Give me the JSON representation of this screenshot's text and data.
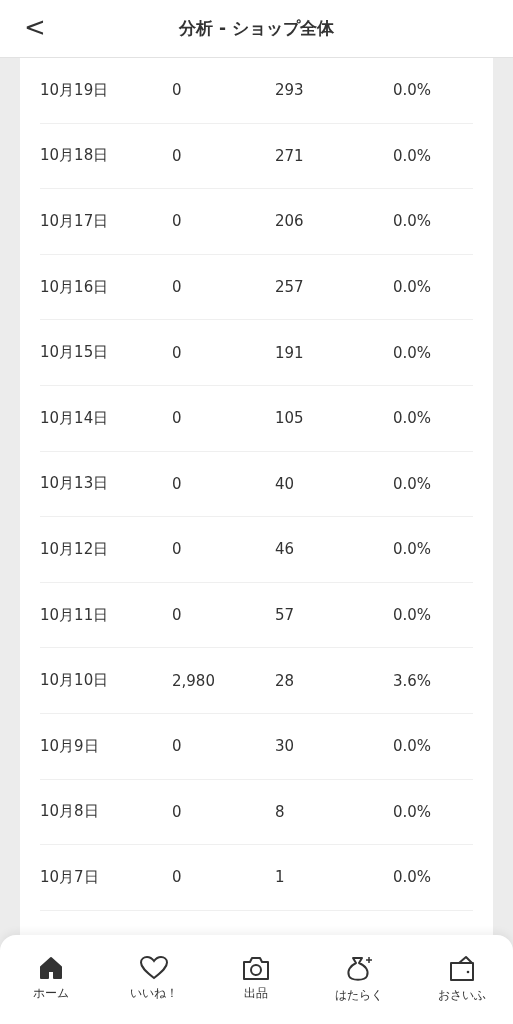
{
  "header": {
    "back": "<",
    "title": "分析 - ショップ全体"
  },
  "rows": [
    {
      "date": "10月19日",
      "column_2": "0",
      "column_3": "293",
      "column_4": "0.0%"
    },
    {
      "date": "10月18日",
      "column_2": "0",
      "column_3": "271",
      "column_4": "0.0%"
    },
    {
      "date": "10月17日",
      "column_2": "0",
      "column_3": "206",
      "column_4": "0.0%"
    },
    {
      "date": "10月16日",
      "column_2": "0",
      "column_3": "257",
      "column_4": "0.0%"
    },
    {
      "date": "10月15日",
      "column_2": "0",
      "column_3": "191",
      "column_4": "0.0%"
    },
    {
      "date": "10月14日",
      "column_2": "0",
      "column_3": "105",
      "column_4": "0.0%"
    },
    {
      "date": "10月13日",
      "column_2": "0",
      "column_3": "40",
      "column_4": "0.0%"
    },
    {
      "date": "10月12日",
      "column_2": "0",
      "column_3": "46",
      "column_4": "0.0%"
    },
    {
      "date": "10月11日",
      "column_2": "0",
      "column_3": "57",
      "column_4": "0.0%"
    },
    {
      "date": "10月10日",
      "column_2": "2,980",
      "column_3": "28",
      "column_4": "3.6%"
    },
    {
      "date": "10月9日",
      "column_2": "0",
      "column_3": "30",
      "column_4": "0.0%"
    },
    {
      "date": "10月8日",
      "column_2": "0",
      "column_3": "8",
      "column_4": "0.0%"
    },
    {
      "date": "10月7日",
      "column_2": "0",
      "column_3": "1",
      "column_4": "0.0%"
    }
  ],
  "tab_bar": [
    {
      "kind": "home",
      "label": "ホーム",
      "selected": true
    },
    {
      "kind": "heart",
      "label": "いいね！",
      "selected": false
    },
    {
      "kind": "camera",
      "label": "出品",
      "selected": false
    },
    {
      "kind": "bag",
      "label": "はたらく",
      "selected": false
    },
    {
      "kind": "wallet",
      "label": "おさいふ",
      "selected": false
    }
  ]
}
